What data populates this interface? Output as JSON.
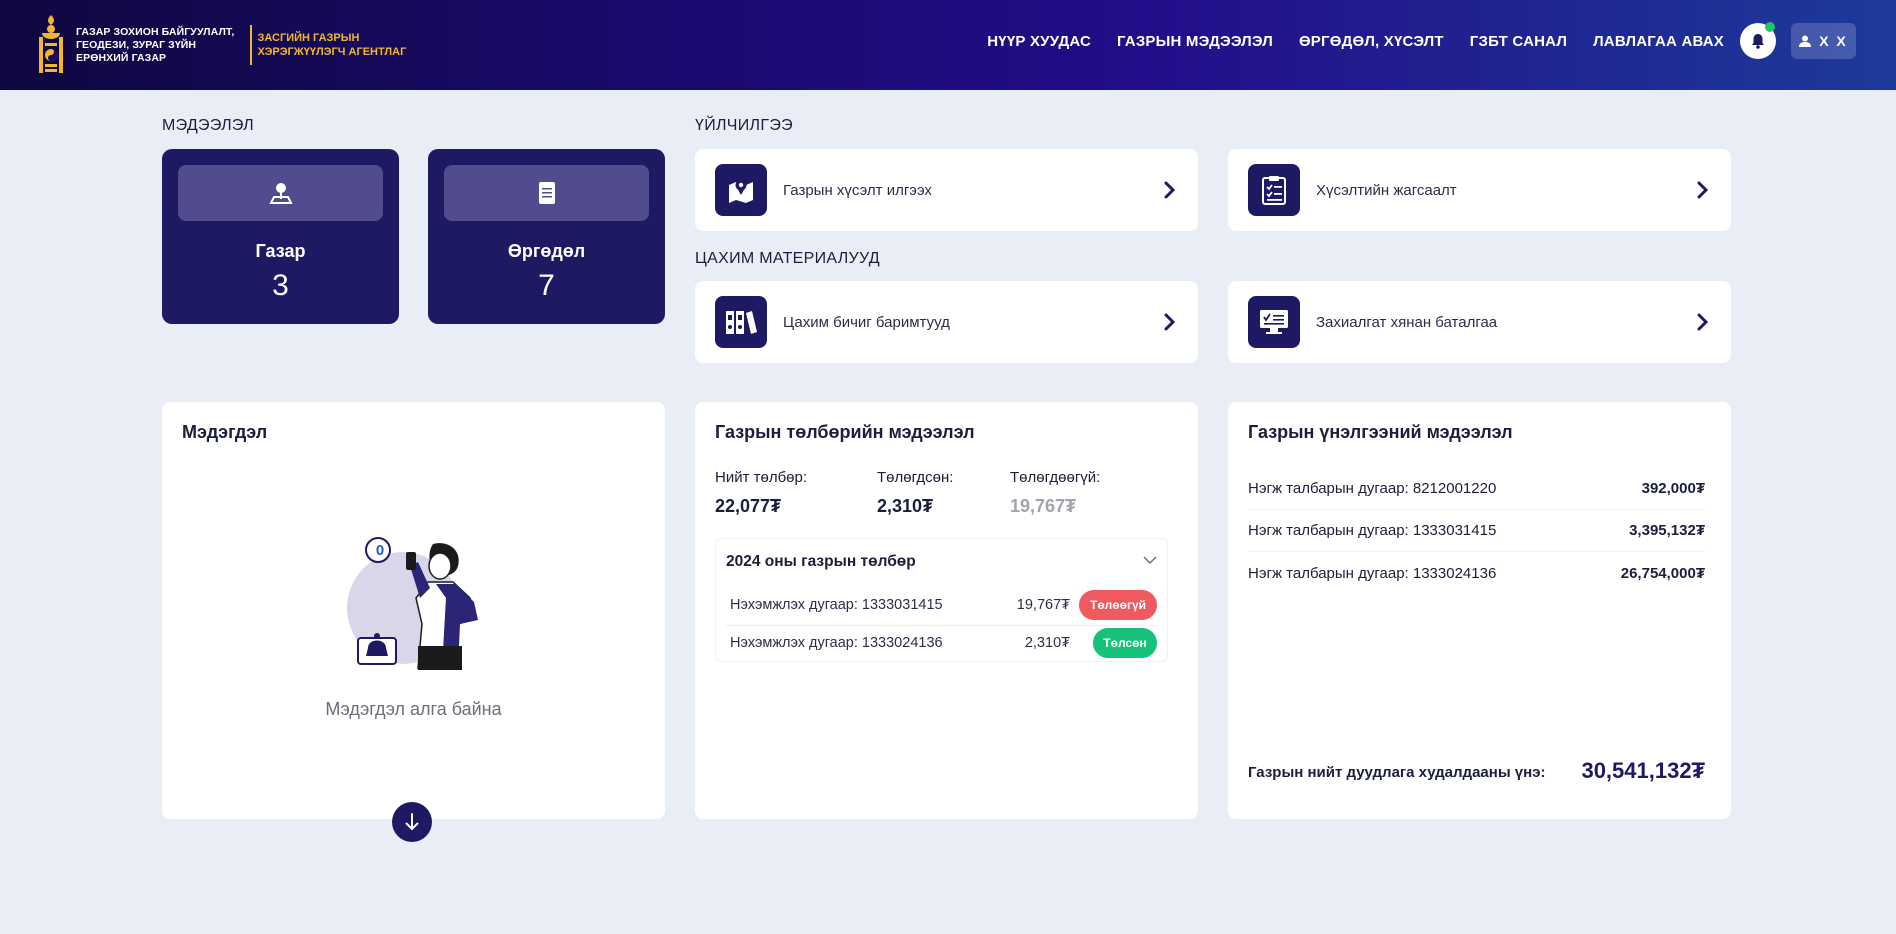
{
  "header": {
    "brand_line1": "ГАЗАР ЗОХИОН БАЙГУУЛАЛТ,",
    "brand_line2": "ГЕОДЕЗИ, ЗУРАГ ЗҮЙН",
    "brand_line3": "ЕРӨНХИЙ ГАЗАР",
    "brand2_line1": "ЗАСГИЙН ГАЗРЫН",
    "brand2_line2": "ХЭРЭГЖҮҮЛЭГЧ АГЕНТЛАГ",
    "nav": [
      "НҮҮР ХУУДАС",
      "ГАЗРЫН МЭДЭЭЛЭЛ",
      "ӨРГӨДӨЛ, ХҮСЭЛТ",
      "ГЗБТ САНАЛ",
      "ЛАВЛАГАА АВАХ"
    ],
    "user_initials": "X X",
    "notification_icon": "bell-icon",
    "user_icon": "user-icon",
    "accent": "#f2b632"
  },
  "info": {
    "title": "МЭДЭЭЛЭЛ",
    "cards": [
      {
        "label": "Газар",
        "value": "3",
        "icon": "map-pin-icon"
      },
      {
        "label": "Өргөдөл",
        "value": "7",
        "icon": "document-icon"
      }
    ]
  },
  "services": {
    "title": "ҮЙЛЧИЛГЭЭ",
    "items": [
      {
        "label": "Газрын хүсэлт илгээх",
        "icon": "map-location-icon"
      },
      {
        "label": "Хүсэлтийн жагсаалт",
        "icon": "clipboard-list-icon"
      }
    ]
  },
  "materials": {
    "title": "ЦАХИМ МАТЕРИАЛУУД",
    "items": [
      {
        "label": "Цахим бичиг баримтууд",
        "icon": "binders-icon"
      },
      {
        "label": "Захиалгат хянан баталгаа",
        "icon": "monitor-check-icon"
      }
    ]
  },
  "notices": {
    "title": "Мэдэгдэл",
    "count": "0",
    "empty_text": "Мэдэгдэл алга байна"
  },
  "payment": {
    "title": "Газрын төлбөрийн мэдээлэл",
    "total_label": "Нийт төлбөр:",
    "total_value": "22,077₮",
    "paid_label": "Төлөгдсөн:",
    "paid_value": "2,310₮",
    "unpaid_label": "Төлөгдөөгүй:",
    "unpaid_value": "19,767₮",
    "year_title": "2024 оны газрын төлбөр",
    "rows": [
      {
        "cert": "Нэхэмжлэх дугаар: 1333031415",
        "amount": "19,767₮",
        "status": "Төлөөгүй"
      },
      {
        "cert": "Нэхэмжлэх дугаар: 1333024136",
        "amount": "2,310₮",
        "status": "Төлсөн"
      }
    ],
    "colors": {
      "unpaid": "#ef5a5f",
      "paid": "#16c17a"
    }
  },
  "valuation": {
    "title": "Газрын үнэлгээний мэдээлэл",
    "rows": [
      {
        "label": "Нэгж талбарын дугаар: 8212001220",
        "price": "392,000₮"
      },
      {
        "label": "Нэгж талбарын дугаар: 1333031415",
        "price": "3,395,132₮"
      },
      {
        "label": "Нэгж талбарын дугаар: 1333024136",
        "price": "26,754,000₮"
      }
    ],
    "total_label": "Газрын нийт дуудлага худалдааны үнэ:",
    "total_value": "30,541,132₮"
  }
}
